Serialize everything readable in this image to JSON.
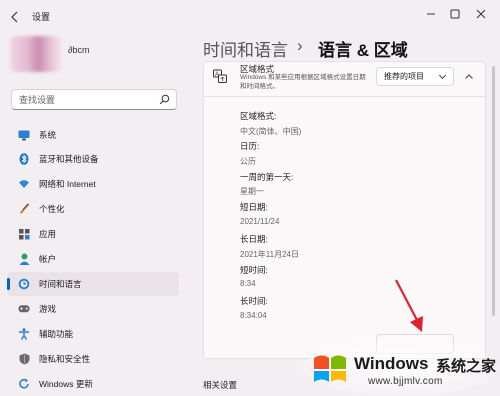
{
  "window": {
    "title": "设置",
    "controls": [
      "minimize",
      "maximize",
      "close"
    ]
  },
  "profile": {
    "name": "∂bcm"
  },
  "search": {
    "placeholder": "查找设置"
  },
  "sidebar": {
    "items": [
      {
        "label": "系统",
        "icon": "monitor-icon",
        "active": false
      },
      {
        "label": "蓝牙和其他设备",
        "icon": "bluetooth-icon",
        "active": false
      },
      {
        "label": "网络和 Internet",
        "icon": "wifi-icon",
        "active": false
      },
      {
        "label": "个性化",
        "icon": "brush-icon",
        "active": false
      },
      {
        "label": "应用",
        "icon": "apps-icon",
        "active": false
      },
      {
        "label": "帐户",
        "icon": "person-icon",
        "active": false
      },
      {
        "label": "时间和语言",
        "icon": "globe-clock-icon",
        "active": true
      },
      {
        "label": "游戏",
        "icon": "gamepad-icon",
        "active": false
      },
      {
        "label": "辅助功能",
        "icon": "accessibility-icon",
        "active": false
      },
      {
        "label": "隐私和安全性",
        "icon": "shield-icon",
        "active": false
      },
      {
        "label": "Windows 更新",
        "icon": "update-icon",
        "active": false
      }
    ]
  },
  "header": {
    "parent": "时间和语言",
    "separator": "›",
    "current": "语言 & 区域"
  },
  "region_format": {
    "title": "区域格式",
    "description": "Windows 和某些应用根据区域格式设置日期和时间格式。",
    "dropdown_value": "推荐的项目",
    "details": [
      {
        "label": "区域格式:",
        "value": "中文(简体、中国)"
      },
      {
        "label": "日历:",
        "value": "公历"
      },
      {
        "label": "一周的第一天:",
        "value": "星期一"
      },
      {
        "label": "短日期:",
        "value": "2021/11/24"
      },
      {
        "label": "长日期:",
        "value": "2021年11月24日"
      },
      {
        "label": "短时间:",
        "value": "8:34"
      },
      {
        "label": "长时间:",
        "value": "8:34:04"
      }
    ]
  },
  "related": {
    "title": "相关设置"
  },
  "watermark": {
    "brand": "Windows",
    "suffix": "系统之家",
    "url": "www.bjjmlv.com"
  },
  "colors": {
    "accent": "#0067c0",
    "background": "#f3eef2",
    "card": "#fbf8fa",
    "arrow": "#e0222c"
  }
}
